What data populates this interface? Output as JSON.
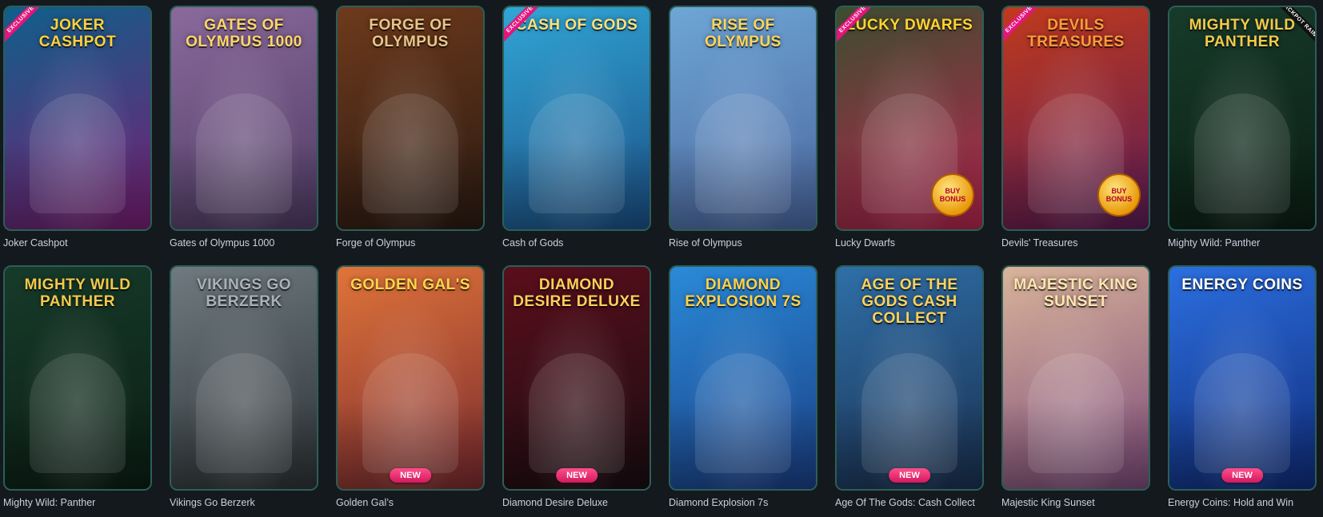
{
  "games": [
    {
      "title": "Joker Cashpot",
      "logo": "JOKER CASHPOT",
      "flag": "EXCLUSIVE",
      "bg": [
        "#0f5f8a",
        "#7a1e74"
      ],
      "logo_color": "#ffd23a"
    },
    {
      "title": "Gates of Olympus 1000",
      "logo": "GATES OF OLYMPUS 1000",
      "bg": [
        "#8a6a9c",
        "#4f3b63"
      ],
      "logo_color": "#ffd76a"
    },
    {
      "title": "Forge of Olympus",
      "logo": "FORGE OF OLYMPUS",
      "bg": [
        "#6e3a1c",
        "#2a1a12"
      ],
      "logo_color": "#e8c58a"
    },
    {
      "title": "Cash of Gods",
      "logo": "CASH OF GODS",
      "flag": "EXCLUSIVE",
      "bg": [
        "#31a6d6",
        "#1b4f86"
      ],
      "logo_color": "#ffe07a"
    },
    {
      "title": "Rise of Olympus",
      "logo": "RISE OF OLYMPUS",
      "bg": [
        "#6ea6d6",
        "#4b67a0"
      ],
      "logo_color": "#ffd65a"
    },
    {
      "title": "Lucky Dwarfs",
      "logo": "LUCKY DWARFS",
      "flag": "EXCLUSIVE",
      "bonus": "BUY BONUS",
      "bg": [
        "#3c4d2f",
        "#b8254f"
      ],
      "logo_color": "#ffd52e"
    },
    {
      "title": "Devils' Treasures",
      "logo": "DEVILS TREASURES",
      "flag": "EXCLUSIVE",
      "bonus": "BUY BONUS",
      "bg": [
        "#c13a1c",
        "#5b1b56"
      ],
      "logo_color": "#ff9b3a"
    },
    {
      "title": "Mighty Wild: Panther",
      "logo": "MIGHTY WILD PANTHER",
      "corner": "JACKPOT RAIN",
      "bg": [
        "#173b2a",
        "#0b1e14"
      ],
      "logo_color": "#f2c94c"
    },
    {
      "title": "Mighty Wild: Panther",
      "logo": "MIGHTY WILD PANTHER",
      "bg": [
        "#173b2a",
        "#0b1e14"
      ],
      "logo_color": "#f2c94c"
    },
    {
      "title": "Vikings Go Berzerk",
      "logo": "VIKINGS GO BERZERK",
      "bg": [
        "#6f7a80",
        "#2c3235"
      ],
      "logo_color": "#a9b2b8"
    },
    {
      "title": "Golden Gal’s",
      "logo": "GOLDEN GAL'S",
      "badge": "NEW",
      "bg": [
        "#e0743a",
        "#7a2a2f"
      ],
      "logo_color": "#ffd64a"
    },
    {
      "title": "Diamond Desire Deluxe",
      "logo": "DIAMOND DESIRE DELUXE",
      "badge": "NEW",
      "bg": [
        "#5a0e1b",
        "#1a0d12"
      ],
      "logo_color": "#ffcf5a"
    },
    {
      "title": "Diamond Explosion 7s",
      "logo": "Diamond EXPLOSION 7s",
      "bg": [
        "#2a8ad8",
        "#1a3f86"
      ],
      "logo_color": "#ffd24a"
    },
    {
      "title": "Age Of The Gods: Cash Collect",
      "logo": "AGE OF THE GODS CASH COLLECT",
      "badge": "NEW",
      "bg": [
        "#2f6fa8",
        "#1a3050"
      ],
      "logo_color": "#ffd35a"
    },
    {
      "title": "Majestic King Sunset",
      "logo": "Majestic King SUNSET",
      "bg": [
        "#d9b49a",
        "#7c4a7a"
      ],
      "logo_color": "#ffe6b0"
    },
    {
      "title": "Energy Coins: Hold and Win",
      "logo": "ENERGY COINS",
      "badge": "NEW",
      "bg": [
        "#2c6fe0",
        "#0f2c7a"
      ],
      "logo_color": "#ffffff"
    }
  ]
}
